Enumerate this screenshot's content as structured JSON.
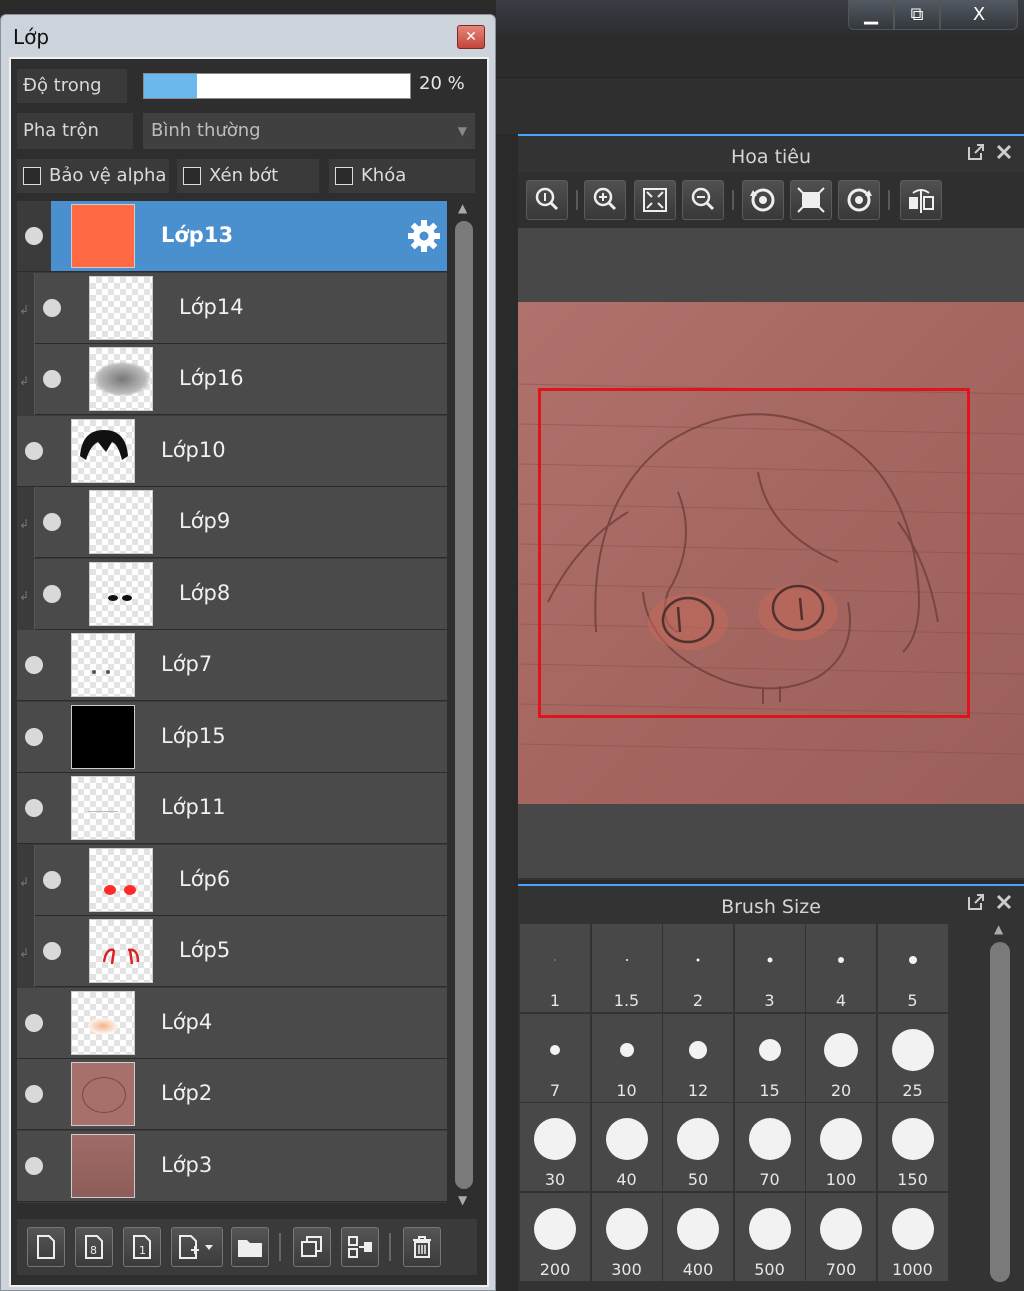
{
  "window": {
    "minimize": "▁",
    "maximize": "⧉",
    "close": "X"
  },
  "layer_panel": {
    "title": "Lớp",
    "close": "✕",
    "opacity_label": "Độ trong",
    "opacity_value": "20 %",
    "opacity_fraction": 0.2,
    "blend_label": "Pha trộn",
    "blend_value": "Bình thường",
    "checkboxes": [
      "Bảo vệ alpha",
      "Xén bớt",
      "Khóa"
    ],
    "layers": [
      {
        "name": "Lớp13",
        "selected": true,
        "clipped": false,
        "thumb": "orange-fill"
      },
      {
        "name": "Lớp14",
        "selected": false,
        "clipped": true,
        "thumb": "transparent"
      },
      {
        "name": "Lớp16",
        "selected": false,
        "clipped": true,
        "thumb": "gray-blur"
      },
      {
        "name": "Lớp10",
        "selected": false,
        "clipped": false,
        "thumb": "black-hair"
      },
      {
        "name": "Lớp9",
        "selected": false,
        "clipped": true,
        "thumb": "transparent"
      },
      {
        "name": "Lớp8",
        "selected": false,
        "clipped": true,
        "thumb": "black-eyes"
      },
      {
        "name": "Lớp7",
        "selected": false,
        "clipped": false,
        "thumb": "dots"
      },
      {
        "name": "Lớp15",
        "selected": false,
        "clipped": false,
        "thumb": "black-fill"
      },
      {
        "name": "Lớp11",
        "selected": false,
        "clipped": false,
        "thumb": "faint"
      },
      {
        "name": "Lớp6",
        "selected": false,
        "clipped": true,
        "thumb": "red-eyes"
      },
      {
        "name": "Lớp5",
        "selected": false,
        "clipped": true,
        "thumb": "red-lines"
      },
      {
        "name": "Lớp4",
        "selected": false,
        "clipped": false,
        "thumb": "peach"
      },
      {
        "name": "Lớp2",
        "selected": false,
        "clipped": false,
        "thumb": "sketch"
      },
      {
        "name": "Lớp3",
        "selected": false,
        "clipped": false,
        "thumb": "mauve-fill"
      }
    ],
    "toolbar_icons": [
      "new-layer-icon",
      "new-8bit-layer-icon",
      "new-1bit-layer-icon",
      "add-layer-menu-icon",
      "new-folder-icon",
      "duplicate-layer-icon",
      "merge-layer-icon",
      "delete-layer-icon"
    ]
  },
  "navigator": {
    "title": "Hoa tiêu",
    "tools": [
      "zoom-fit-icon",
      "zoom-in-icon",
      "fit-screen-icon",
      "zoom-out-icon",
      "rotate-left-icon",
      "reset-view-icon",
      "rotate-right-icon",
      "flip-horizontal-icon"
    ]
  },
  "brush_size": {
    "title": "Brush Size",
    "sizes": [
      "1",
      "1.5",
      "2",
      "3",
      "4",
      "5",
      "7",
      "10",
      "12",
      "15",
      "20",
      "25",
      "30",
      "40",
      "50",
      "70",
      "100",
      "150",
      "200",
      "300",
      "400",
      "500",
      "700",
      "1000"
    ]
  },
  "colors": {
    "selection": "#4a90cf",
    "accent": "#4aa3ff",
    "view_rect": "#e0141c",
    "canvas": "#a56660"
  }
}
